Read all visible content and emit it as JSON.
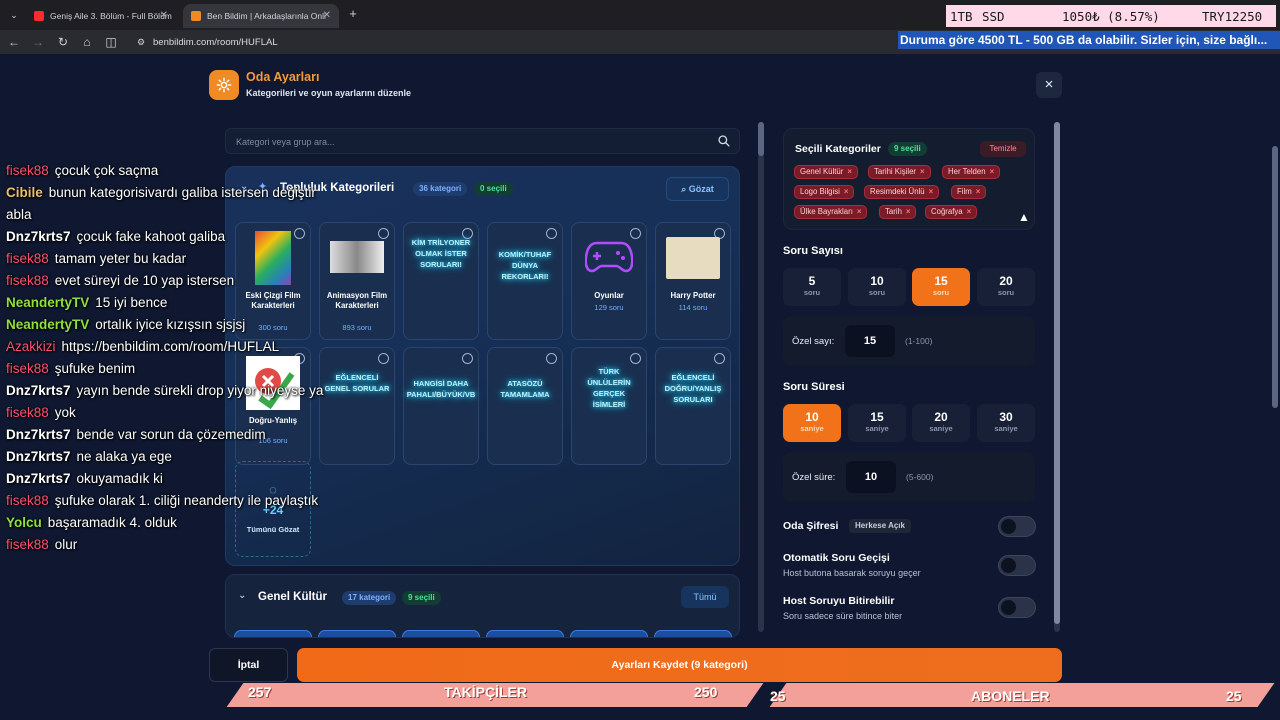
{
  "browser": {
    "tabs": [
      {
        "title": "Geniş Aile 3. Bölüm - Full Bölüm"
      },
      {
        "title": "Ben Bildim | Arkadaşlarınla Onli"
      }
    ],
    "new_tab": "+",
    "url": "benbildim.com/room/HUFLAL"
  },
  "stream_overlay": {
    "ssd_bar": {
      "size": "1TB",
      "label": "SSD",
      "price": "1050₺ (8.57%)",
      "code": "TRY12250"
    },
    "ticker": "Duruma göre 4500 TL - 500 GB da olabilir. Sizler için, size bağlı...",
    "followers": {
      "left": "257",
      "label": "TAKİPÇİLER",
      "right": "250"
    },
    "subscribers": {
      "left": "25",
      "label": "ABONELER",
      "right": "25"
    }
  },
  "modal": {
    "title": "Oda Ayarları",
    "subtitle": "Kategorileri ve oyun ayarlarını düzenle",
    "close": "×",
    "search_placeholder": "Kategori veya grup ara...",
    "community": {
      "title": "Topluluk Kategorileri",
      "count_badge": "36 kategori",
      "selected_badge": "0 seçili",
      "explore": "Gözat",
      "cards": [
        {
          "title": "Eski Çizgi Film Karakterleri",
          "count": "300 soru"
        },
        {
          "title": "Animasyon Film Karakterleri",
          "count": "893 soru"
        },
        {
          "title": "",
          "art": "KİM TRİLYONER OLMAK İSTER SORULARI!"
        },
        {
          "title": "",
          "art": "KOMİK/TUHAF DÜNYA REKORLARI!"
        },
        {
          "title": "Oyunlar",
          "count": "129 soru"
        },
        {
          "title": "Harry Potter",
          "count": "114 soru"
        },
        {
          "title": "Doğru-Yanlış",
          "count": "106 soru"
        },
        {
          "title": "",
          "art": "EĞLENCELİ GENEL SORULAR"
        },
        {
          "title": "",
          "art": "HANGİSİ DAHA PAHALI/BÜYÜK/VB"
        },
        {
          "title": "",
          "art": "ATASÖZÜ TAMAMLAMA"
        },
        {
          "title": "",
          "art": "TÜRK ÜNLÜLERİN GERÇEK İSİMLERİ"
        },
        {
          "title": "",
          "art": "EĞLENCELİ DOĞRU/YANLIŞ SORULARI"
        }
      ],
      "more_count": "+24",
      "more_label": "Tümünü Gözat"
    },
    "genel_kultur": {
      "title": "Genel Kültür",
      "count_badge": "17 kategori",
      "selected_badge": "9 seçili",
      "all": "Tümü"
    },
    "selected": {
      "title": "Seçili Kategoriler",
      "badge": "9 seçili",
      "clear": "Temizle",
      "chips": [
        "Genel Kültür",
        "Tarihi Kişiler",
        "Her Telden",
        "Logo Bilgisi",
        "Resimdeki Ünlü",
        "Film",
        "Ülke Bayrakları",
        "Tarih",
        "Coğrafya"
      ]
    },
    "question_count": {
      "title": "Soru Sayısı",
      "unit": "soru",
      "options": [
        "5",
        "10",
        "15",
        "20"
      ],
      "selected": "15",
      "custom_label": "Özel sayı:",
      "custom_value": "15",
      "custom_hint": "(1-100)"
    },
    "question_time": {
      "title": "Soru Süresi",
      "unit": "saniye",
      "options": [
        "10",
        "15",
        "20",
        "30"
      ],
      "selected": "10",
      "custom_label": "Özel süre:",
      "custom_value": "10",
      "custom_hint": "(5-600)"
    },
    "room_password": {
      "title": "Oda Şifresi",
      "badge": "Herkese Açık",
      "enabled": false
    },
    "auto_next": {
      "title": "Otomatik Soru Geçişi",
      "subtitle": "Host butona basarak soruyu geçer",
      "enabled": false
    },
    "host_finish": {
      "title": "Host Soruyu Bitirebilir",
      "subtitle": "Soru sadece süre bitince biter",
      "enabled": false
    },
    "cancel": "İptal",
    "save": "Ayarları Kaydet (9 kategori)"
  },
  "chat": [
    {
      "user": "fisek88",
      "color": "#ff4f6d",
      "msg": "çocuk çok saçma"
    },
    {
      "user": "Cibile",
      "color": "#e8c06a",
      "msg": "bunun kategorisivardı galiba istersen değiştir"
    },
    {
      "user": "",
      "color": "#ffffff",
      "msg": "abla"
    },
    {
      "user": "Dnz7krts7",
      "color": "#ffffff",
      "msg": "çocuk fake kahoot galiba"
    },
    {
      "user": "fisek88",
      "color": "#ff4f6d",
      "msg": "tamam yeter bu kadar"
    },
    {
      "user": "fisek88",
      "color": "#ff4f6d",
      "msg": "evet süreyi de 10 yap istersen"
    },
    {
      "user": "NeandertyTV",
      "color": "#8fe03a",
      "msg": "15 iyi bence"
    },
    {
      "user": "NeandertyTV",
      "color": "#8fe03a",
      "msg": "ortalık iyice kızışsın sjsjsj"
    },
    {
      "user": "Azakkizi",
      "color": "#ff4f6d",
      "msg": "https://benbildim.com/room/HUFLAL"
    },
    {
      "user": "fisek88",
      "color": "#ff4f6d",
      "msg": "şufuke benim"
    },
    {
      "user": "Dnz7krts7",
      "color": "#ffffff",
      "msg": "yayın bende sürekli drop yiyor niyeyse ya"
    },
    {
      "user": "fisek88",
      "color": "#ff4f6d",
      "msg": "yok"
    },
    {
      "user": "Dnz7krts7",
      "color": "#ffffff",
      "msg": "bende var sorun da çözemedim"
    },
    {
      "user": "Dnz7krts7",
      "color": "#ffffff",
      "msg": "ne alaka ya ege"
    },
    {
      "user": "Dnz7krts7",
      "color": "#ffffff",
      "msg": "okuyamadık ki"
    },
    {
      "user": "fisek88",
      "color": "#ff4f6d",
      "msg": "şufuke olarak 1. ciliği neanderty ile paylaştık"
    },
    {
      "user": "Yolcu",
      "color": "#8fe03a",
      "msg": "başaramadık 4. olduk"
    },
    {
      "user": "fisek88",
      "color": "#ff4f6d",
      "msg": "olur"
    }
  ]
}
